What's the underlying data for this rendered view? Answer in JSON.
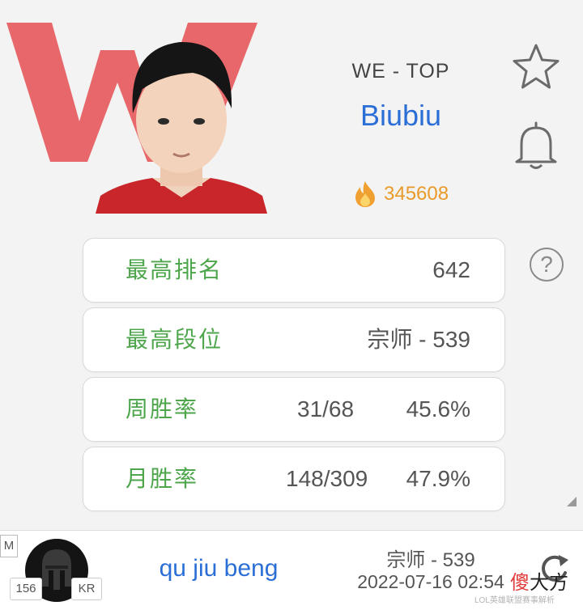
{
  "header": {
    "team_role": "WE - TOP",
    "player_name": "Biubiu",
    "heat_value": "345608"
  },
  "stats": [
    {
      "label": "最高排名",
      "count": "",
      "value": "642"
    },
    {
      "label": "最高段位",
      "count": "",
      "value": "宗师 - 539"
    },
    {
      "label": "周胜率",
      "count": "31/68",
      "value": "45.6%"
    },
    {
      "label": "月胜率",
      "count": "148/309",
      "value": "47.9%"
    }
  ],
  "help_symbol": "?",
  "account": {
    "mode_badge": "M",
    "level": "156",
    "region": "KR",
    "name": "qu jiu beng",
    "rank": "宗师 - 539",
    "time": "2022-07-16 02:54"
  },
  "watermark": {
    "logo_char_1": "傻",
    "logo_chars_rest": "大方",
    "text": "LOL英雄联盟赛事解析"
  },
  "colors": {
    "accent_blue": "#2b6fd6",
    "label_green": "#4ea64c",
    "heat_orange": "#e99a2a",
    "team_red": "#e8676a"
  },
  "icons": {
    "star": "star-icon",
    "bell": "bell-icon",
    "help": "question-icon",
    "fire": "fire-icon",
    "refresh": "refresh-icon"
  }
}
